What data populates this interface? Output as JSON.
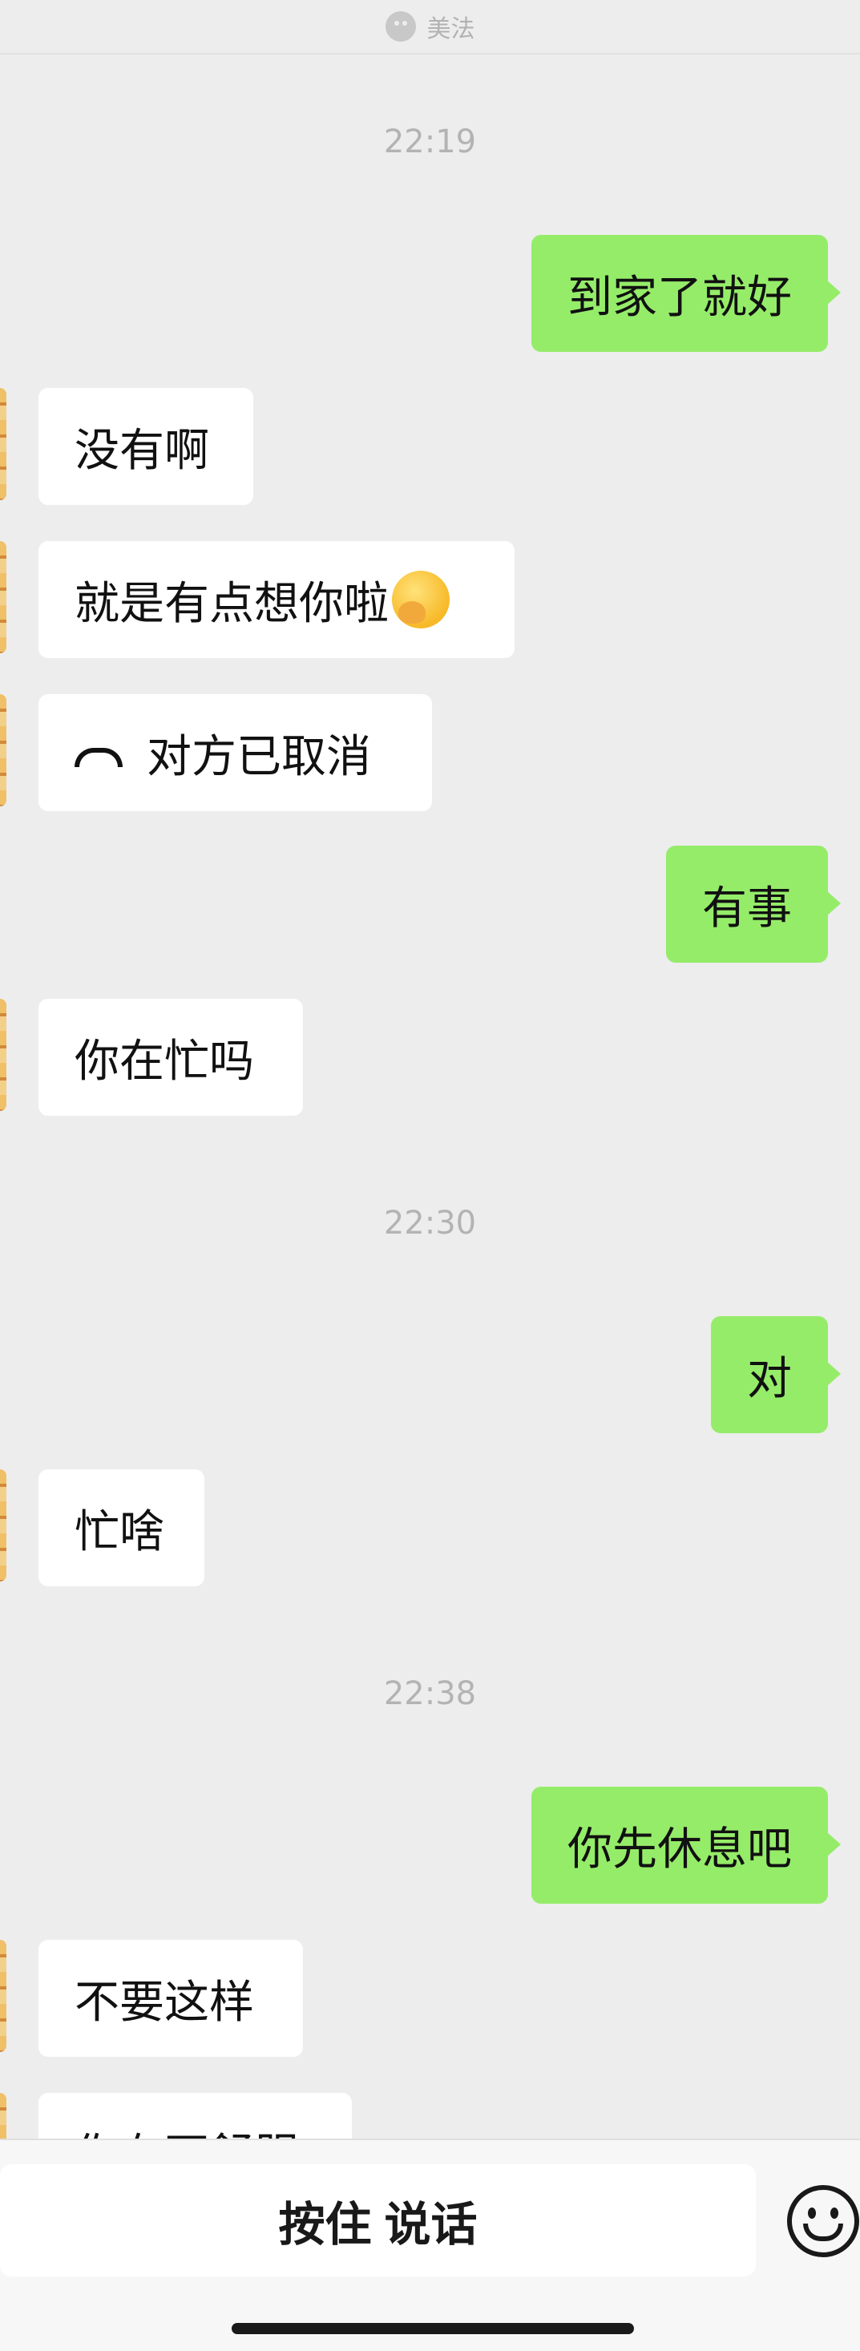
{
  "header": {
    "title": "美法"
  },
  "chat": {
    "timestamps": [
      "22:19",
      "22:30",
      "22:38"
    ],
    "messages": [
      {
        "side": "right",
        "text": "到家了就好"
      },
      {
        "side": "left",
        "text": "没有啊"
      },
      {
        "side": "left",
        "text": "就是有点想你啦",
        "emoji": "hand-over-mouth-emoji"
      },
      {
        "side": "left",
        "text": "对方已取消",
        "icon": "phone-hangup-icon"
      },
      {
        "side": "right",
        "text": "有事"
      },
      {
        "side": "left",
        "text": "你在忙吗"
      },
      {
        "side": "right",
        "text": "对"
      },
      {
        "side": "left",
        "text": "忙啥"
      },
      {
        "side": "right",
        "text": "你先休息吧"
      },
      {
        "side": "left",
        "text": "不要这样"
      },
      {
        "side": "left",
        "text": "你有不舒服"
      }
    ]
  },
  "input_bar": {
    "hold_to_talk_label": "按住 说话",
    "emoji_button_icon": "smiley-face-icon"
  },
  "colors": {
    "background": "#ededed",
    "sent_bubble": "#95ec69",
    "received_bubble": "#ffffff"
  }
}
